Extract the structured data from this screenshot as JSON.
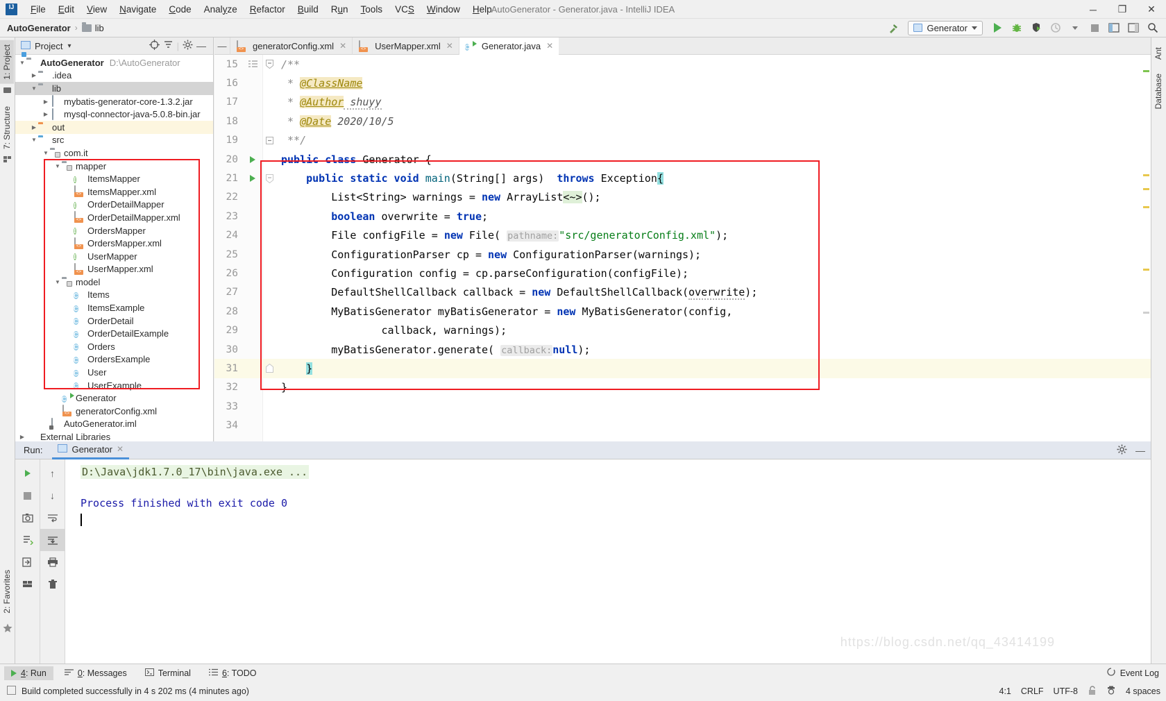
{
  "window": {
    "title": "AutoGenerator - Generator.java - IntelliJ IDEA",
    "logo": "intellij-idea-logo",
    "minimize": "─",
    "maximize": "❐",
    "close": "✕"
  },
  "menubar": {
    "items": [
      {
        "pre": "",
        "mn": "F",
        "post": "ile"
      },
      {
        "pre": "",
        "mn": "E",
        "post": "dit"
      },
      {
        "pre": "",
        "mn": "V",
        "post": "iew"
      },
      {
        "pre": "",
        "mn": "N",
        "post": "avigate"
      },
      {
        "pre": "",
        "mn": "C",
        "post": "ode"
      },
      {
        "pre": "Anal",
        "mn": "y",
        "post": "ze"
      },
      {
        "pre": "",
        "mn": "R",
        "post": "efactor"
      },
      {
        "pre": "",
        "mn": "B",
        "post": "uild"
      },
      {
        "pre": "R",
        "mn": "u",
        "post": "n"
      },
      {
        "pre": "",
        "mn": "T",
        "post": "ools"
      },
      {
        "pre": "VC",
        "mn": "S",
        "post": ""
      },
      {
        "pre": "",
        "mn": "W",
        "post": "indow"
      },
      {
        "pre": "",
        "mn": "H",
        "post": "elp"
      }
    ]
  },
  "navbar": {
    "project": "AutoGenerator",
    "separator": "›",
    "crumb2": "lib",
    "build_icon": "hammer-icon",
    "run_config": "Generator",
    "run_icon": "run-icon",
    "debug_icon": "debug-icon",
    "run_coverage_icon": "run-with-coverage-icon",
    "profiler_icon": "profiler-icon",
    "stop_icon": "stop-icon",
    "layout_icon": "layout-icon",
    "search_icon": "search-icon"
  },
  "left_strip": {
    "tabs": [
      {
        "label": "1: Project",
        "selected": true
      },
      {
        "label": "7: Structure",
        "selected": false
      }
    ],
    "bottom_tab": "2: Favorites",
    "favorites_icon": "star-icon"
  },
  "right_strip": {
    "tabs": [
      "Ant",
      "Database"
    ]
  },
  "project_panel": {
    "title": "Project",
    "title_icon": "project-icon",
    "chevron": "▾",
    "icons": {
      "locate": "target-icon",
      "collapse": "collapse-all-icon",
      "settings": "gear-icon",
      "hide": "hide-icon"
    },
    "tree": [
      {
        "indent": 0,
        "arrow": "▼",
        "icon": "module",
        "label": "AutoGenerator",
        "bold": true,
        "path": "D:\\AutoGenerator",
        "state": "normal"
      },
      {
        "indent": 1,
        "arrow": "▶",
        "icon": "folder-gray",
        "label": ".idea",
        "state": "normal"
      },
      {
        "indent": 1,
        "arrow": "▼",
        "icon": "folder-gray",
        "label": "lib",
        "state": "selected"
      },
      {
        "indent": 2,
        "arrow": "▶",
        "icon": "jar",
        "label": "mybatis-generator-core-1.3.2.jar",
        "state": "normal"
      },
      {
        "indent": 2,
        "arrow": "▶",
        "icon": "jar",
        "label": "mysql-connector-java-5.0.8-bin.jar",
        "state": "normal"
      },
      {
        "indent": 1,
        "arrow": "▶",
        "icon": "folder-orange",
        "label": "out",
        "state": "highlight"
      },
      {
        "indent": 1,
        "arrow": "▼",
        "icon": "folder-blue",
        "label": "src",
        "state": "normal"
      },
      {
        "indent": 2,
        "arrow": "▼",
        "icon": "package",
        "label": "com.it",
        "state": "normal"
      },
      {
        "indent": 3,
        "arrow": "▼",
        "icon": "package",
        "label": "mapper",
        "state": "normal"
      },
      {
        "indent": 4,
        "arrow": "",
        "icon": "interface",
        "label": "ItemsMapper",
        "state": "normal"
      },
      {
        "indent": 4,
        "arrow": "",
        "icon": "xml",
        "label": "ItemsMapper.xml",
        "state": "normal"
      },
      {
        "indent": 4,
        "arrow": "",
        "icon": "interface",
        "label": "OrderDetailMapper",
        "state": "normal"
      },
      {
        "indent": 4,
        "arrow": "",
        "icon": "xml",
        "label": "OrderDetailMapper.xml",
        "state": "normal"
      },
      {
        "indent": 4,
        "arrow": "",
        "icon": "interface",
        "label": "OrdersMapper",
        "state": "normal"
      },
      {
        "indent": 4,
        "arrow": "",
        "icon": "xml",
        "label": "OrdersMapper.xml",
        "state": "normal"
      },
      {
        "indent": 4,
        "arrow": "",
        "icon": "interface",
        "label": "UserMapper",
        "state": "normal"
      },
      {
        "indent": 4,
        "arrow": "",
        "icon": "xml",
        "label": "UserMapper.xml",
        "state": "normal"
      },
      {
        "indent": 3,
        "arrow": "▼",
        "icon": "package",
        "label": "model",
        "state": "normal"
      },
      {
        "indent": 4,
        "arrow": "",
        "icon": "class",
        "label": "Items",
        "state": "normal"
      },
      {
        "indent": 4,
        "arrow": "",
        "icon": "class",
        "label": "ItemsExample",
        "state": "normal"
      },
      {
        "indent": 4,
        "arrow": "",
        "icon": "class",
        "label": "OrderDetail",
        "state": "normal"
      },
      {
        "indent": 4,
        "arrow": "",
        "icon": "class",
        "label": "OrderDetailExample",
        "state": "normal"
      },
      {
        "indent": 4,
        "arrow": "",
        "icon": "class",
        "label": "Orders",
        "state": "normal"
      },
      {
        "indent": 4,
        "arrow": "",
        "icon": "class",
        "label": "OrdersExample",
        "state": "normal"
      },
      {
        "indent": 4,
        "arrow": "",
        "icon": "class",
        "label": "User",
        "state": "normal"
      },
      {
        "indent": 4,
        "arrow": "",
        "icon": "class",
        "label": "UserExample",
        "state": "normal"
      },
      {
        "indent": 3,
        "arrow": "",
        "icon": "class-runnable",
        "label": "Generator",
        "state": "normal"
      },
      {
        "indent": 3,
        "arrow": "",
        "icon": "xml",
        "label": "generatorConfig.xml",
        "state": "normal"
      },
      {
        "indent": 2,
        "arrow": "",
        "icon": "iml",
        "label": "AutoGenerator.iml",
        "state": "normal"
      },
      {
        "indent": 0,
        "arrow": "▶",
        "icon": "external-libraries",
        "label": "External Libraries",
        "state": "normal"
      }
    ]
  },
  "editor": {
    "collapse_icon": "collapse-icon",
    "tabs": [
      {
        "label": "generatorConfig.xml",
        "icon": "xml",
        "active": false,
        "close": "✕"
      },
      {
        "label": "UserMapper.xml",
        "icon": "xml",
        "active": false,
        "close": "✕"
      },
      {
        "label": "Generator.java",
        "icon": "class-runnable",
        "active": true,
        "close": "✕"
      }
    ],
    "lines": [
      {
        "no": "15",
        "mark": "javadoc-fold",
        "kind": "comment-open"
      },
      {
        "no": "16",
        "mark": "",
        "kind": "javadoc-tag",
        "tag": "@ClassName",
        "value": ""
      },
      {
        "no": "17",
        "mark": "",
        "kind": "javadoc-tag",
        "tag": "@Author",
        "value": "shuyy"
      },
      {
        "no": "18",
        "mark": "",
        "kind": "javadoc-tag",
        "tag": "@Date",
        "value": "2020/10/5"
      },
      {
        "no": "19",
        "mark": "fold",
        "kind": "comment-close"
      },
      {
        "no": "20",
        "mark": "run-gutter",
        "kind": "code"
      },
      {
        "no": "21",
        "mark": "run-gutter",
        "kind": "code"
      },
      {
        "no": "22",
        "mark": "",
        "kind": "code"
      },
      {
        "no": "23",
        "mark": "",
        "kind": "code"
      },
      {
        "no": "24",
        "mark": "",
        "kind": "code"
      },
      {
        "no": "25",
        "mark": "",
        "kind": "code"
      },
      {
        "no": "26",
        "mark": "",
        "kind": "code"
      },
      {
        "no": "27",
        "mark": "",
        "kind": "code"
      },
      {
        "no": "28",
        "mark": "",
        "kind": "code"
      },
      {
        "no": "29",
        "mark": "",
        "kind": "code"
      },
      {
        "no": "30",
        "mark": "",
        "kind": "code"
      },
      {
        "no": "31",
        "mark": "fold",
        "kind": "code"
      },
      {
        "no": "32",
        "mark": "",
        "kind": "code"
      },
      {
        "no": "33",
        "mark": "",
        "kind": "code"
      },
      {
        "no": "34",
        "mark": "",
        "kind": "code"
      }
    ],
    "code": {
      "l15": "/**",
      "l16_star": " * ",
      "l16_tag": "@ClassName",
      "l17_star": " * ",
      "l17_tag": "@Author",
      "l17_val": " shuyy",
      "l18_star": " * ",
      "l18_tag": "@Date",
      "l18_val": " 2020/10/5",
      "l19": " **/",
      "l20_kw1": "public",
      "l20_kw2": "class",
      "l20_name": " Generator {",
      "l21_kw": "public static void",
      "l21_method": "main",
      "l21_args": "(String[] args)  ",
      "l21_throws": "throws",
      "l21_ex": " Exception",
      "l21_brace": "{",
      "l22_a": "List<String> warnings = ",
      "l22_new": "new",
      "l22_b": " ArrayList",
      "l22_diamond": "<~>",
      "l22_c": "();",
      "l23_kw": "boolean",
      "l23_a": " overwrite = ",
      "l23_true": "true",
      "l23_b": ";",
      "l24_a": "File configFile = ",
      "l24_new": "new",
      "l24_b": " File( ",
      "l24_hint": "pathname:",
      "l24_str": "\"src/generatorConfig.xml\"",
      "l24_c": ");",
      "l25_a": "ConfigurationParser cp = ",
      "l25_new": "new",
      "l25_b": " ConfigurationParser(warnings);",
      "l26": "Configuration config = cp.parseConfiguration(configFile);",
      "l27_a": "DefaultShellCallback callback = ",
      "l27_new": "new",
      "l27_b": " DefaultShellCallback(",
      "l27_arg": "overwrite",
      "l27_c": ");",
      "l28_a": "MyBatisGenerator myBatisGenerator = ",
      "l28_new": "new",
      "l28_b": " MyBatisGenerator(config,",
      "l29": "callback, warnings);",
      "l30_a": "myBatisGenerator.generate( ",
      "l30_hint": "callback:",
      "l30_null": "null",
      "l30_b": ");",
      "l31": "}",
      "l32": "}"
    }
  },
  "run_panel": {
    "label": "Run:",
    "tab": "Generator",
    "tab_icon": "run-config-icon",
    "tab_close": "✕",
    "head_icons": {
      "settings": "gear-icon",
      "hide": "hide-icon"
    },
    "tools_left": [
      "rerun-icon",
      "stop-icon",
      "screenshot-icon",
      "dump-threads-icon",
      "export-icon",
      "layout-icon"
    ],
    "tools_right": [
      "scroll-up-icon",
      "scroll-down-icon",
      "soft-wrap-icon",
      "scroll-to-end-icon",
      "print-icon",
      "trash-icon"
    ],
    "console": {
      "command": "D:\\Java\\jdk1.7.0_17\\bin\\java.exe ...",
      "result": "Process finished with exit code 0"
    }
  },
  "tool_tabs": {
    "items": [
      {
        "icon": "run-icon",
        "num": "4",
        "label": ": Run",
        "selected": true
      },
      {
        "icon": "messages-icon",
        "num": "0",
        "label": ": Messages",
        "selected": false
      },
      {
        "icon": "terminal-icon",
        "num": "",
        "label": "Terminal",
        "selected": false
      },
      {
        "icon": "todo-icon",
        "num": "6",
        "label": ": TODO",
        "selected": false
      }
    ],
    "event_log": "Event Log",
    "event_log_icon": "event-log-icon"
  },
  "statusbar": {
    "build_icon": "build-status-icon",
    "message": "Build completed successfully in 4 s 202 ms (4 minutes ago)",
    "caret": "4:1",
    "line_sep": "CRLF",
    "encoding": "UTF-8",
    "lock_icon": "unlock-icon",
    "inspection_icon": "hector-icon",
    "indent": "4 spaces"
  },
  "watermark": "https://blog.csdn.net/qq_43414199",
  "colors": {
    "accent_blue": "#4a90d9",
    "red_box": "#ef1c22",
    "green_run": "#4caf50",
    "keyword": "#0033b3",
    "string": "#067d17",
    "comment_tag": "#9e880d"
  }
}
